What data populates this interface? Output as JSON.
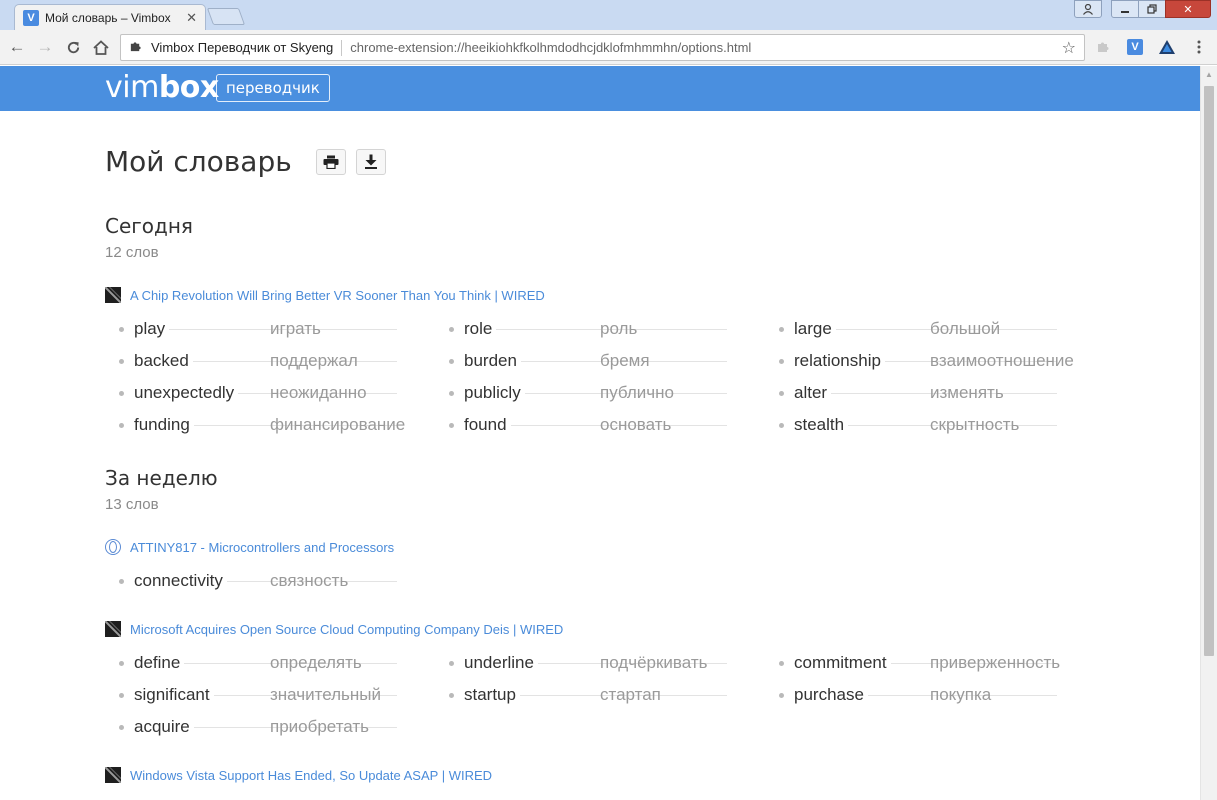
{
  "browser": {
    "tab_title": "Мой словарь – Vimbox ",
    "tab_favicon": "V",
    "omnibox_title": "Vimbox Переводчик от Skyeng",
    "url": "chrome-extension://heeikiohkfkolhmdodhcjdklofmhmmhn/options.html",
    "ext_badge": "V"
  },
  "app": {
    "logo_light": "vim",
    "logo_bold": "box",
    "badge": "переводчик"
  },
  "page": {
    "title": "Мой словарь"
  },
  "sections": [
    {
      "title": "Сегодня",
      "count": "12 слов",
      "sources": [
        {
          "icon": "wired-icon",
          "title": "A Chip Revolution Will Bring Better VR Sooner Than You Think | WIRED",
          "words": [
            {
              "term": "play",
              "translation": "играть"
            },
            {
              "term": "backed",
              "translation": "поддержал"
            },
            {
              "term": "unexpectedly",
              "translation": "неожиданно"
            },
            {
              "term": "funding",
              "translation": "финансирование"
            },
            {
              "term": "role",
              "translation": "роль"
            },
            {
              "term": "burden",
              "translation": "бремя"
            },
            {
              "term": "publicly",
              "translation": "публично"
            },
            {
              "term": "found",
              "translation": "основать"
            },
            {
              "term": "large",
              "translation": "большой"
            },
            {
              "term": "relationship",
              "translation": "взаимоотношение"
            },
            {
              "term": "alter",
              "translation": "изменять"
            },
            {
              "term": "stealth",
              "translation": "скрытность"
            }
          ]
        }
      ]
    },
    {
      "title": "За неделю",
      "count": "13 слов",
      "sources": [
        {
          "icon": "globe-icon",
          "title": "ATTINY817 - Microcontrollers and Processors",
          "words": [
            {
              "term": "connectivity",
              "translation": "связность"
            }
          ]
        },
        {
          "icon": "wired-icon",
          "title": "Microsoft Acquires Open Source Cloud Computing Company Deis | WIRED",
          "words": [
            {
              "term": "define",
              "translation": "определять"
            },
            {
              "term": "significant",
              "translation": "значительный"
            },
            {
              "term": "acquire",
              "translation": "приобретать"
            },
            {
              "term": "underline",
              "translation": "подчёркивать"
            },
            {
              "term": "startup",
              "translation": "стартап"
            },
            {
              "term": "commitment",
              "translation": "приверженность"
            },
            {
              "term": "purchase",
              "translation": "покупка"
            }
          ]
        },
        {
          "icon": "wired-icon",
          "title": "Windows Vista Support Has Ended, So Update ASAP | WIRED",
          "words": []
        }
      ]
    }
  ]
}
